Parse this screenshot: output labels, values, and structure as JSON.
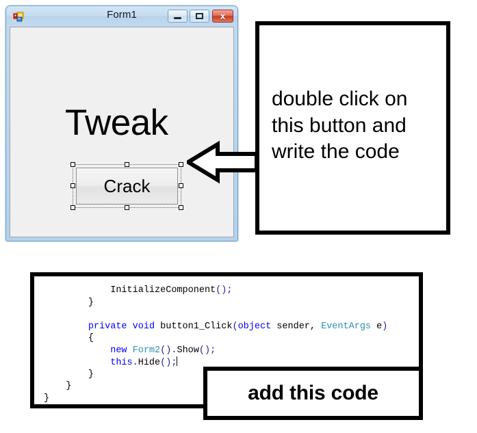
{
  "form_window": {
    "title": "Form1",
    "icon": "vs-form-icon",
    "controls": {
      "minimize_label": "Minimize",
      "maximize_label": "Maximize",
      "close_label": "x"
    },
    "heading_label": "Tweak",
    "selected_button_label": "Crack",
    "client_background": "#f0f0f0",
    "frame_color": "#bad6ee"
  },
  "annotation": {
    "arrow": "left-arrow",
    "text": "double click on\nthis button and\nwrite the code"
  },
  "code_box": {
    "lines": [
      {
        "indent": 12,
        "segments": [
          {
            "t": "InitializeComponent",
            "c": "plain"
          },
          {
            "t": "();",
            "c": "punct"
          }
        ]
      },
      {
        "indent": 8,
        "segments": [
          {
            "t": "}",
            "c": "plain"
          }
        ]
      },
      {
        "indent": 0,
        "segments": [
          {
            "t": "",
            "c": "plain"
          }
        ]
      },
      {
        "indent": 8,
        "segments": [
          {
            "t": "private",
            "c": "kw"
          },
          {
            "t": " ",
            "c": "plain"
          },
          {
            "t": "void",
            "c": "kw"
          },
          {
            "t": " button1_Click",
            "c": "plain"
          },
          {
            "t": "(",
            "c": "punct"
          },
          {
            "t": "object",
            "c": "kw"
          },
          {
            "t": " sender, ",
            "c": "plain"
          },
          {
            "t": "EventArgs",
            "c": "typ"
          },
          {
            "t": " e",
            "c": "plain"
          },
          {
            "t": ")",
            "c": "punct"
          }
        ]
      },
      {
        "indent": 8,
        "segments": [
          {
            "t": "{",
            "c": "plain"
          }
        ]
      },
      {
        "indent": 12,
        "segments": [
          {
            "t": "new",
            "c": "kw"
          },
          {
            "t": " ",
            "c": "plain"
          },
          {
            "t": "Form2",
            "c": "typ"
          },
          {
            "t": "().",
            "c": "punct"
          },
          {
            "t": "Show",
            "c": "plain"
          },
          {
            "t": "();",
            "c": "punct"
          }
        ]
      },
      {
        "indent": 12,
        "segments": [
          {
            "t": "this",
            "c": "kw"
          },
          {
            "t": ".",
            "c": "punct"
          },
          {
            "t": "Hide",
            "c": "plain"
          },
          {
            "t": "();",
            "c": "punct"
          },
          {
            "t": "CARET",
            "c": "caret"
          }
        ]
      },
      {
        "indent": 8,
        "segments": [
          {
            "t": "}",
            "c": "plain"
          }
        ]
      },
      {
        "indent": 4,
        "segments": [
          {
            "t": "}",
            "c": "plain"
          }
        ]
      },
      {
        "indent": 0,
        "segments": [
          {
            "t": "}",
            "c": "plain"
          }
        ]
      }
    ]
  },
  "add_code_box": {
    "text": "add this code"
  }
}
